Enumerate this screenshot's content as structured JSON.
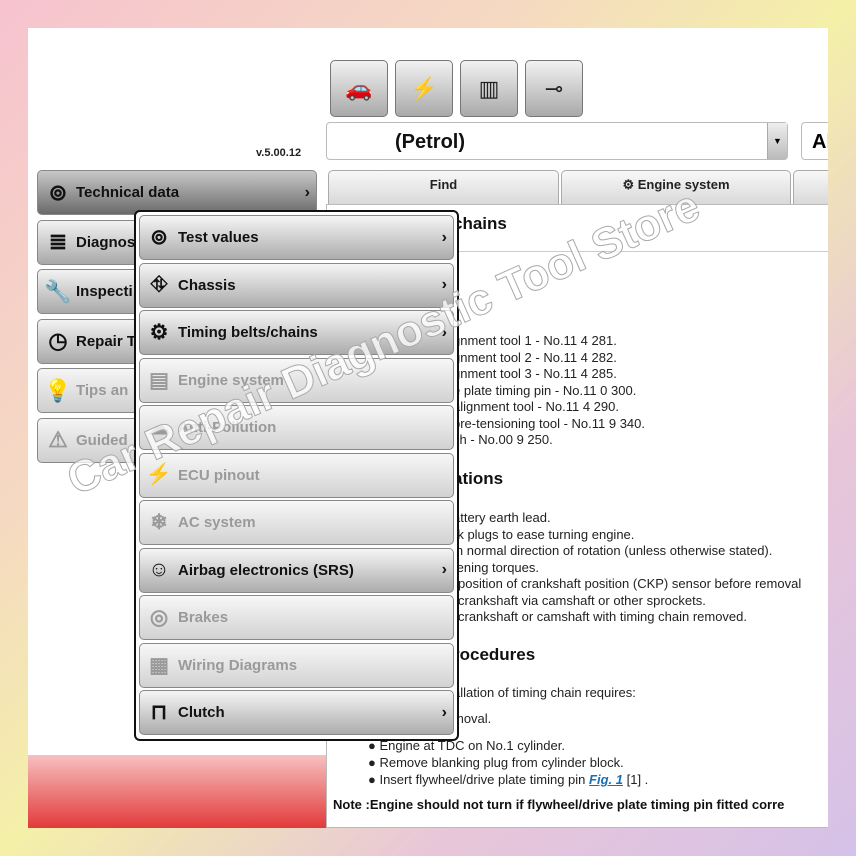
{
  "version": "v.5.00.12",
  "toolbar": [
    {
      "icon": "vehicles-icon",
      "glyph": "🚗"
    },
    {
      "icon": "engine-electric-icon",
      "glyph": "⚡"
    },
    {
      "icon": "battery-icon",
      "glyph": "▥"
    },
    {
      "icon": "connector-icon",
      "glyph": "⊸"
    }
  ],
  "vehicle_select": {
    "value": "(Petrol)",
    "second_value": "Al"
  },
  "tabs": [
    {
      "label": "Find"
    },
    {
      "label": "Engine system"
    }
  ],
  "sidebar": [
    {
      "label": "Technical data",
      "glyph": "⊚"
    },
    {
      "label": "Diagnos",
      "glyph": "≣"
    },
    {
      "label": "Inspecti",
      "glyph": "🔧"
    },
    {
      "label": "Repair T",
      "glyph": "◷"
    },
    {
      "label": "Tips an",
      "glyph": "💡"
    },
    {
      "label": "Guided",
      "glyph": "⚠"
    }
  ],
  "menu": [
    {
      "label": "Test values",
      "glyph": "⊚",
      "enabled": true
    },
    {
      "label": "Chassis",
      "glyph": "⛗",
      "enabled": true
    },
    {
      "label": "Timing belts/chains",
      "glyph": "⚙",
      "enabled": true
    },
    {
      "label": "Engine system",
      "glyph": "▤",
      "enabled": false
    },
    {
      "label": "Anti-Pollution",
      "glyph": "☁",
      "enabled": false
    },
    {
      "label": "ECU pinout",
      "glyph": "⚡",
      "enabled": false
    },
    {
      "label": "AC system",
      "glyph": "❄",
      "enabled": false
    },
    {
      "label": "Airbag electronics (SRS)",
      "glyph": "☺",
      "enabled": true
    },
    {
      "label": "Brakes",
      "glyph": "◎",
      "enabled": false
    },
    {
      "label": "Wiring Diagrams",
      "glyph": "▦",
      "enabled": false
    },
    {
      "label": "Clutch",
      "glyph": "⊓",
      "enabled": true
    }
  ],
  "content": {
    "title": "chains",
    "tools": [
      "gnment tool 1 - No.11 4 281.",
      "gnment tool 2 - No.11 4 282.",
      "gnment tool 3 - No.11 4 285.",
      "e plate timing pin - No.11 0 300.",
      "alignment tool - No.11 4 290.",
      "pre-tensioning tool - No.11 9 340.",
      "ch - No.00 9 250."
    ],
    "precautions_heading": "ations",
    "precautions": [
      "attery earth lead.",
      "rk plugs to ease turning engine.",
      "in normal direction of rotation (unless otherwise stated).",
      "tening torques.",
      "position of crankshaft position (CKP) sensor before removal",
      "crankshaft via camshaft or other sprockets.",
      "crankshaft or camshaft with timing chain removed."
    ],
    "procedures_heading": "rocedures",
    "proc_line1": "allation of timing chain requires:",
    "proc_line2": "moval.",
    "bullets": [
      "Engine at TDC on No.1 cylinder.",
      "Remove blanking plug from cylinder block.",
      "Insert flywheel/drive plate timing pin"
    ],
    "fig_link": "Fig. 1",
    "fig_ref": " [1] .",
    "note": "Note :Engine should not turn if flywheel/drive plate timing pin fitted corre"
  },
  "watermark": "Car Repair Diagnostic Tool Store"
}
